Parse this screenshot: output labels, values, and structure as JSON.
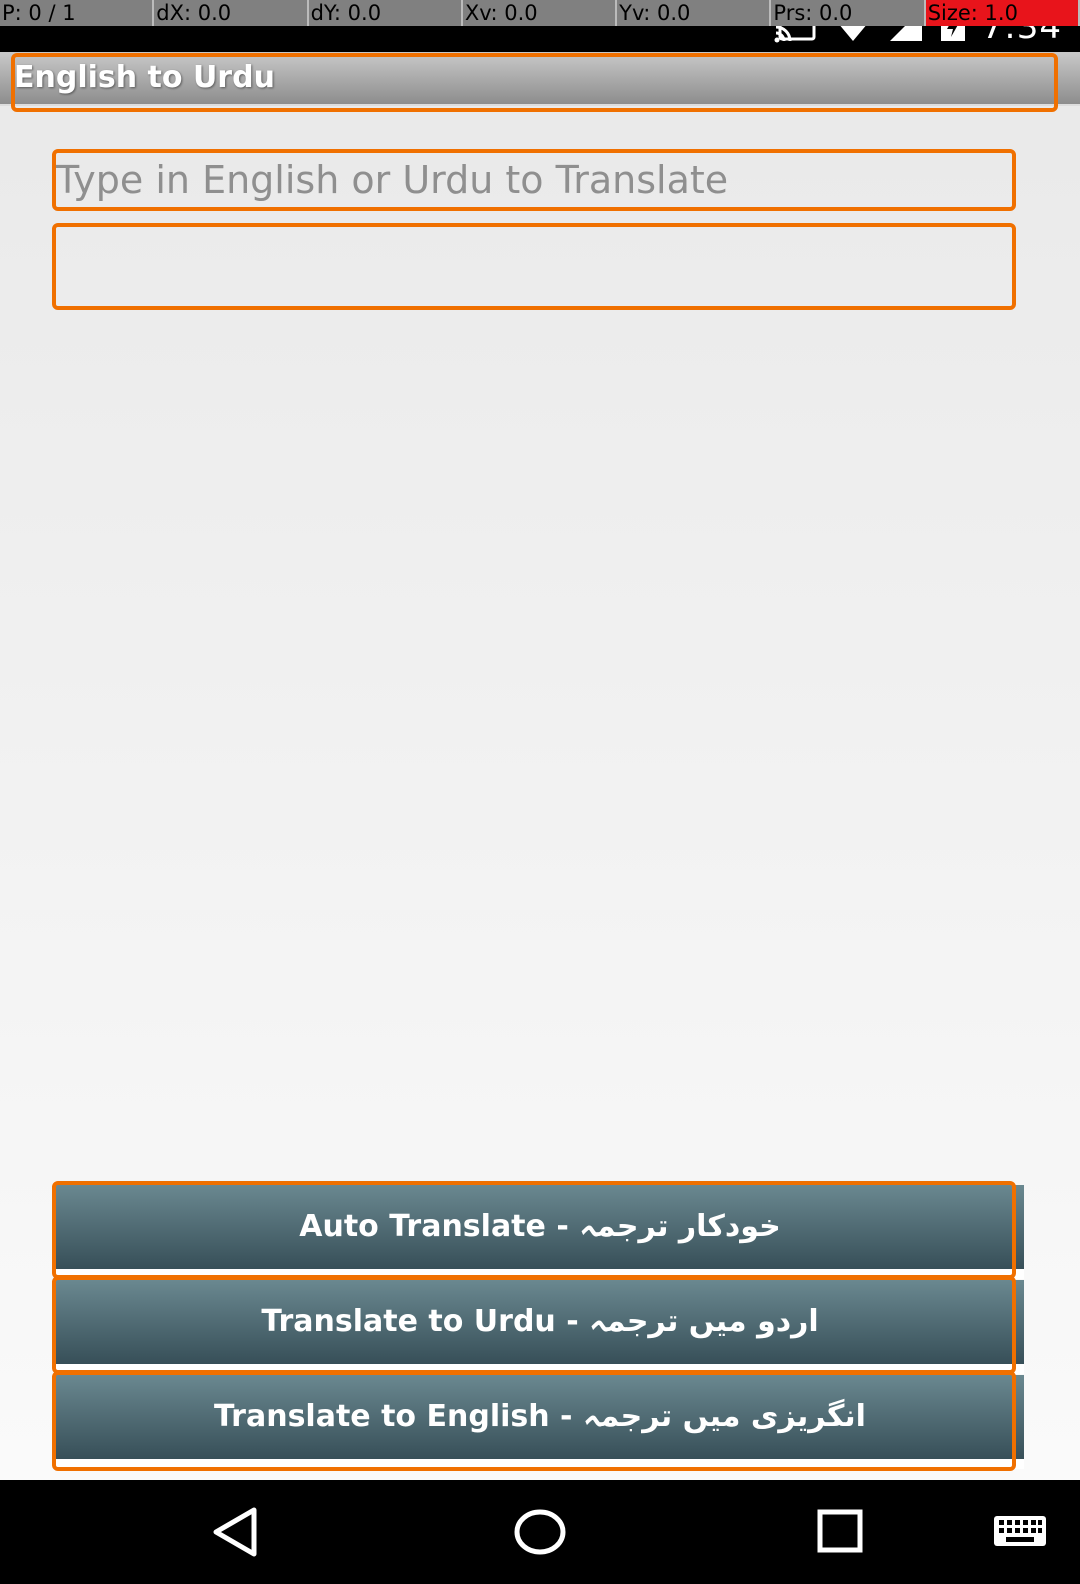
{
  "pointer_overlay": {
    "p": "P: 0 / 1",
    "dx": "dX: 0.0",
    "dy": "dY: 0.0",
    "xv": "Xv: 0.0",
    "yv": "Yv: 0.0",
    "prs": "Prs: 0.0",
    "size": "Size: 1.0"
  },
  "status_bar": {
    "clock": "7:34",
    "icons": [
      "cast-icon",
      "wifi-icon",
      "signal-icon",
      "battery-charging-icon"
    ]
  },
  "app": {
    "title": "English to Urdu",
    "input_placeholder": "Type in English or Urdu to Translate",
    "input_value": "",
    "output_text": ""
  },
  "buttons": {
    "auto": "Auto Translate - خودکار ترجمہ",
    "to_urdu": "Translate to Urdu - اردو میں ترجمہ",
    "to_english": "Translate to English - انگریزی میں ترجمہ"
  },
  "nav_bar": {
    "icons": [
      "back-icon",
      "home-icon",
      "recents-icon",
      "keyboard-icon"
    ]
  },
  "colors": {
    "highlight": "#f07000",
    "button_top": "#6a8890",
    "button_bottom": "#374f58",
    "size_cell": "#e8141b"
  }
}
